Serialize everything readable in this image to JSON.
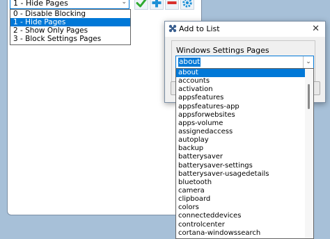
{
  "main": {
    "mode_combo_value": "1 - Hide Pages",
    "mode_options": [
      "0 - Disable Blocking",
      "1 - Hide Pages",
      "2 - Show Only Pages",
      "3 - Block Settings Pages"
    ],
    "selected_mode_index": 1,
    "toolbar": {
      "apply_icon": "checkmark-icon",
      "add_icon": "plus-icon",
      "remove_icon": "minus-icon",
      "settings_icon": "gear-icon"
    }
  },
  "dialog": {
    "title": "Add to List",
    "close_glyph": "✕",
    "group_label": "Windows Settings Pages",
    "combo_value": "about",
    "pages": [
      "about",
      "accounts",
      "activation",
      "appsfeatures",
      "appsfeatures-app",
      "appsforwebsites",
      "apps-volume",
      "assignedaccess",
      "autoplay",
      "backup",
      "batterysaver",
      "batterysaver-settings",
      "batterysaver-usagedetails",
      "bluetooth",
      "camera",
      "clipboard",
      "colors",
      "connecteddevices",
      "controlcenter",
      "cortana-windowssearch"
    ],
    "selected_page_index": 0
  },
  "colors": {
    "accent": "#0078d7",
    "desktop": "#a7c0d8",
    "check_green": "#2faa2f",
    "add_blue": "#1e90d6",
    "remove_red": "#d9302c"
  }
}
